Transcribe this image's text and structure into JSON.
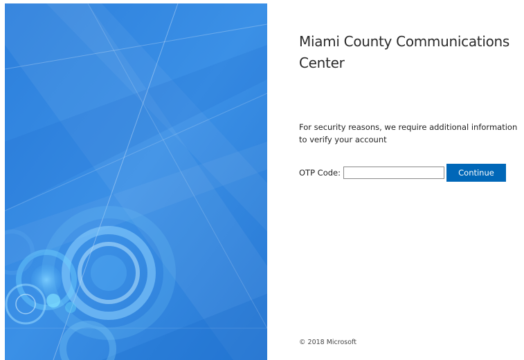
{
  "org_title": "Miami County Communications Center",
  "security_message": "For security reasons, we require additional information to verify your account",
  "otp": {
    "label": "OTP Code:",
    "value": "",
    "placeholder": ""
  },
  "continue_label": "Continue",
  "copyright": "© 2018 Microsoft",
  "colors": {
    "accent": "#0067b8",
    "illustration_blue": "#2f86e0"
  }
}
